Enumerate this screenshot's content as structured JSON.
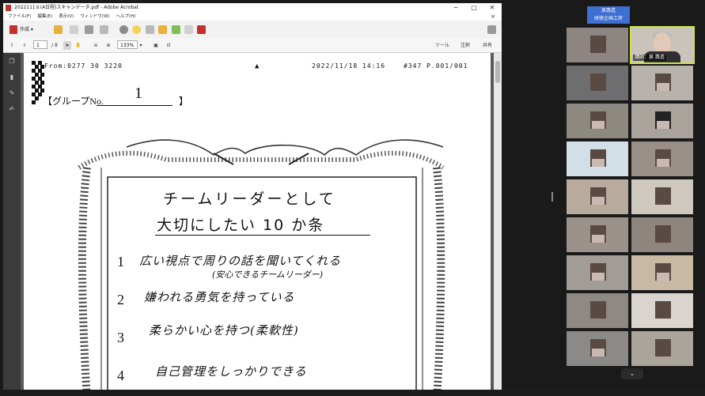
{
  "acrobat": {
    "title": "2022111８(A日程)スキャンデータ.pdf - Adobe Acrobat",
    "window_min": "─",
    "window_max": "□",
    "window_close": "✕",
    "menu": [
      "ファイル(F)",
      "編集(E)",
      "表示(V)",
      "ウィンドウ(W)",
      "ヘルプ(H)"
    ],
    "menu_close": "×",
    "create_label": "作成",
    "page_current": "1",
    "page_total": "/ 8",
    "zoom": "133%",
    "tools_label": "ツール",
    "comment_label": "注釈",
    "share_label": "共有"
  },
  "document": {
    "fax_from": "From:0277 30 3220",
    "fax_datetime": "2022/11/18 14:16",
    "fax_page": "#347 P.001/001",
    "group_label": "【グループNo.",
    "group_number": "1",
    "group_close": "】",
    "heading1": "チームリーダーとして",
    "heading2": "大切にしたい 10 か条",
    "items": [
      {
        "num": "1",
        "text": "広い視点で周りの話を聞いてくれる",
        "sub": "(安心できるチームリーダー)"
      },
      {
        "num": "2",
        "text": "嫌われる勇気を持っている",
        "sub": ""
      },
      {
        "num": "3",
        "text": "柔らかい心を持つ(柔軟性)",
        "sub": ""
      },
      {
        "num": "4",
        "text": "自己管理をしっかりできる",
        "sub": ""
      }
    ]
  },
  "zoom": {
    "name_box_line1": "泉惠造",
    "name_box_line2": "研修企画工房",
    "speaker_label": "講師：泉 惠造",
    "gallery_down": "⌄"
  }
}
